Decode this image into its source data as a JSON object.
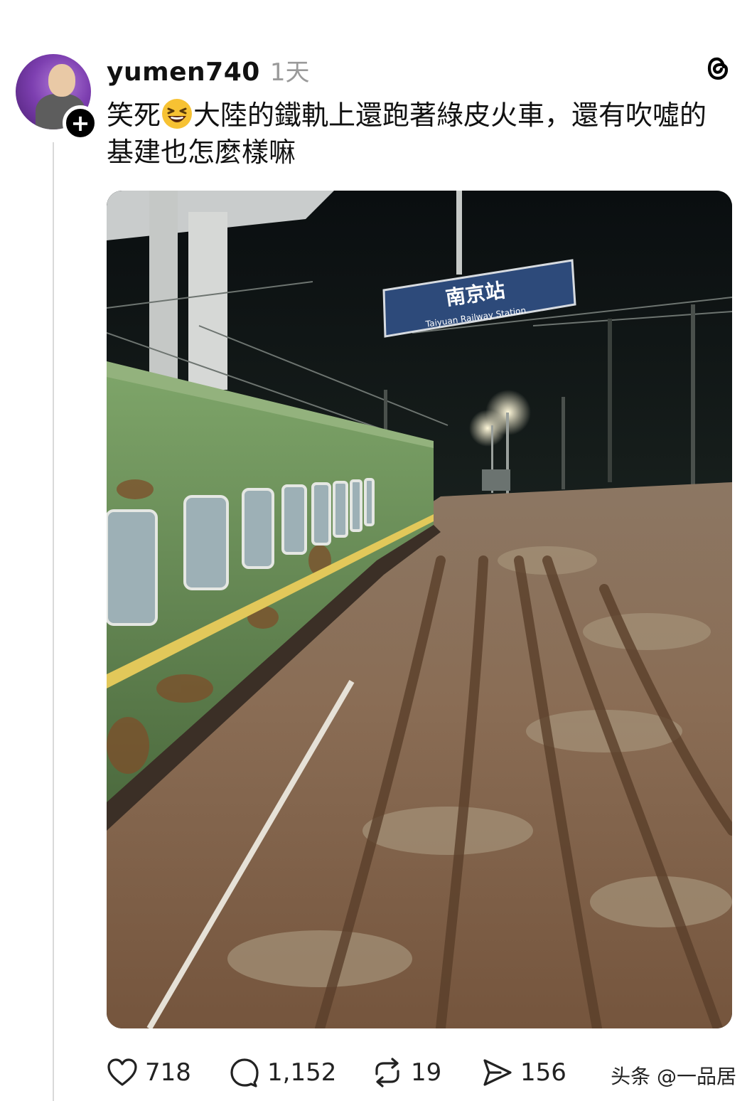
{
  "post": {
    "username": "yumen740",
    "time": "1天",
    "text_before_emoji": "笑死",
    "emoji": "laughing-face-emoji",
    "text_after_emoji": "大陸的鐵軌上還跑著綠皮火車，還有吹噓的基建也怎麼樣嘛"
  },
  "photo": {
    "station_sign_title": "南京站",
    "station_sign_subtitle": "Taiyuan Railway Station"
  },
  "actions": {
    "likes": "718",
    "comments": "1,152",
    "reposts": "19",
    "shares": "156"
  },
  "watermark": "头条 @一品居",
  "icons": {
    "follow": "plus-icon",
    "brand": "threads-logo-icon",
    "like": "heart-icon",
    "comment": "comment-icon",
    "repost": "repost-icon",
    "share": "share-icon"
  }
}
